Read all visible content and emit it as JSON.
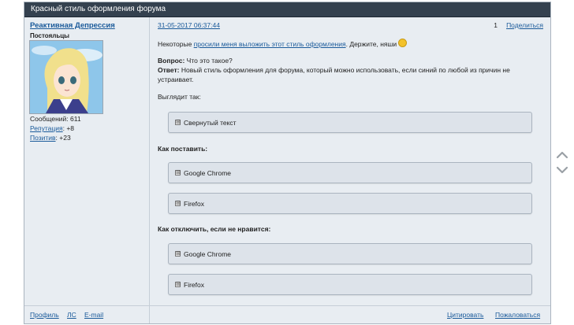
{
  "topic": {
    "title": "Красный стиль оформления форума"
  },
  "author": {
    "name": "Реактивная Депрессия",
    "rank": "Постояльцы",
    "messages_label": "Сообщений:",
    "messages_value": "611",
    "reputation_label": "Репутация",
    "reputation_value": ": +8",
    "positive_label": "Позитив",
    "positive_value": ": +23"
  },
  "post": {
    "date": "31-05-2017 06:37:44",
    "number": "1",
    "share_label": "Поделиться",
    "intro_before": "Некоторые ",
    "intro_link": "просили меня выложить этот стиль оформления",
    "intro_after": ". Держите, няши ",
    "question_label": "Вопрос:",
    "question_text": " Что это такое?",
    "answer_label": "Ответ:",
    "answer_line1": " Новый стиль оформления для форума, который можно использовать, если синий по любой из причин не",
    "answer_line2": "устраивает.",
    "looks_like": "Выглядит так:",
    "spoiler_collapsed": "Свернутый текст",
    "how_install": "Как поставить:",
    "install_chrome": "Google Chrome",
    "install_firefox": "Firefox",
    "how_disable": "Как отключить, если не нравится:",
    "disable_chrome": "Google Chrome",
    "disable_firefox": "Firefox",
    "spoiler_toggle": "⊞"
  },
  "footer": {
    "profile": "Профиль",
    "pm": "ЛС",
    "email": "E-mail",
    "quote": "Цитировать",
    "report": "Пожаловаться"
  },
  "icons": {
    "up": "chevron-up-icon",
    "down": "chevron-down-icon",
    "smiley": "smiley-icon"
  },
  "colors": {
    "header_bg": "#34414f",
    "panel_bg": "#e8edf2",
    "link": "#1a5a9a"
  }
}
